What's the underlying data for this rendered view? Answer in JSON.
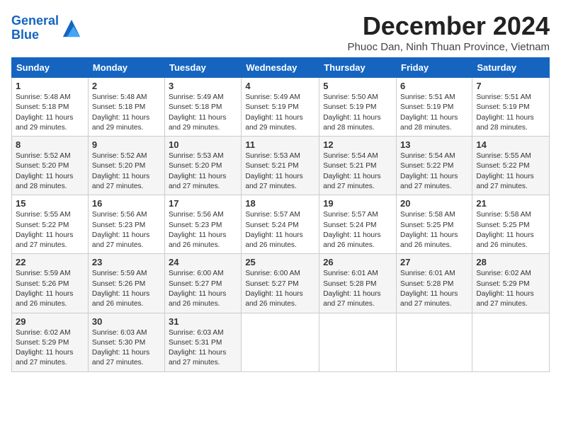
{
  "logo": {
    "line1": "General",
    "line2": "Blue"
  },
  "title": "December 2024",
  "subtitle": "Phuoc Dan, Ninh Thuan Province, Vietnam",
  "headers": [
    "Sunday",
    "Monday",
    "Tuesday",
    "Wednesday",
    "Thursday",
    "Friday",
    "Saturday"
  ],
  "weeks": [
    [
      {
        "day": "1",
        "info": "Sunrise: 5:48 AM\nSunset: 5:18 PM\nDaylight: 11 hours\nand 29 minutes."
      },
      {
        "day": "2",
        "info": "Sunrise: 5:48 AM\nSunset: 5:18 PM\nDaylight: 11 hours\nand 29 minutes."
      },
      {
        "day": "3",
        "info": "Sunrise: 5:49 AM\nSunset: 5:18 PM\nDaylight: 11 hours\nand 29 minutes."
      },
      {
        "day": "4",
        "info": "Sunrise: 5:49 AM\nSunset: 5:19 PM\nDaylight: 11 hours\nand 29 minutes."
      },
      {
        "day": "5",
        "info": "Sunrise: 5:50 AM\nSunset: 5:19 PM\nDaylight: 11 hours\nand 28 minutes."
      },
      {
        "day": "6",
        "info": "Sunrise: 5:51 AM\nSunset: 5:19 PM\nDaylight: 11 hours\nand 28 minutes."
      },
      {
        "day": "7",
        "info": "Sunrise: 5:51 AM\nSunset: 5:19 PM\nDaylight: 11 hours\nand 28 minutes."
      }
    ],
    [
      {
        "day": "8",
        "info": "Sunrise: 5:52 AM\nSunset: 5:20 PM\nDaylight: 11 hours\nand 28 minutes."
      },
      {
        "day": "9",
        "info": "Sunrise: 5:52 AM\nSunset: 5:20 PM\nDaylight: 11 hours\nand 27 minutes."
      },
      {
        "day": "10",
        "info": "Sunrise: 5:53 AM\nSunset: 5:20 PM\nDaylight: 11 hours\nand 27 minutes."
      },
      {
        "day": "11",
        "info": "Sunrise: 5:53 AM\nSunset: 5:21 PM\nDaylight: 11 hours\nand 27 minutes."
      },
      {
        "day": "12",
        "info": "Sunrise: 5:54 AM\nSunset: 5:21 PM\nDaylight: 11 hours\nand 27 minutes."
      },
      {
        "day": "13",
        "info": "Sunrise: 5:54 AM\nSunset: 5:22 PM\nDaylight: 11 hours\nand 27 minutes."
      },
      {
        "day": "14",
        "info": "Sunrise: 5:55 AM\nSunset: 5:22 PM\nDaylight: 11 hours\nand 27 minutes."
      }
    ],
    [
      {
        "day": "15",
        "info": "Sunrise: 5:55 AM\nSunset: 5:22 PM\nDaylight: 11 hours\nand 27 minutes."
      },
      {
        "day": "16",
        "info": "Sunrise: 5:56 AM\nSunset: 5:23 PM\nDaylight: 11 hours\nand 27 minutes."
      },
      {
        "day": "17",
        "info": "Sunrise: 5:56 AM\nSunset: 5:23 PM\nDaylight: 11 hours\nand 26 minutes."
      },
      {
        "day": "18",
        "info": "Sunrise: 5:57 AM\nSunset: 5:24 PM\nDaylight: 11 hours\nand 26 minutes."
      },
      {
        "day": "19",
        "info": "Sunrise: 5:57 AM\nSunset: 5:24 PM\nDaylight: 11 hours\nand 26 minutes."
      },
      {
        "day": "20",
        "info": "Sunrise: 5:58 AM\nSunset: 5:25 PM\nDaylight: 11 hours\nand 26 minutes."
      },
      {
        "day": "21",
        "info": "Sunrise: 5:58 AM\nSunset: 5:25 PM\nDaylight: 11 hours\nand 26 minutes."
      }
    ],
    [
      {
        "day": "22",
        "info": "Sunrise: 5:59 AM\nSunset: 5:26 PM\nDaylight: 11 hours\nand 26 minutes."
      },
      {
        "day": "23",
        "info": "Sunrise: 5:59 AM\nSunset: 5:26 PM\nDaylight: 11 hours\nand 26 minutes."
      },
      {
        "day": "24",
        "info": "Sunrise: 6:00 AM\nSunset: 5:27 PM\nDaylight: 11 hours\nand 26 minutes."
      },
      {
        "day": "25",
        "info": "Sunrise: 6:00 AM\nSunset: 5:27 PM\nDaylight: 11 hours\nand 26 minutes."
      },
      {
        "day": "26",
        "info": "Sunrise: 6:01 AM\nSunset: 5:28 PM\nDaylight: 11 hours\nand 27 minutes."
      },
      {
        "day": "27",
        "info": "Sunrise: 6:01 AM\nSunset: 5:28 PM\nDaylight: 11 hours\nand 27 minutes."
      },
      {
        "day": "28",
        "info": "Sunrise: 6:02 AM\nSunset: 5:29 PM\nDaylight: 11 hours\nand 27 minutes."
      }
    ],
    [
      {
        "day": "29",
        "info": "Sunrise: 6:02 AM\nSunset: 5:29 PM\nDaylight: 11 hours\nand 27 minutes."
      },
      {
        "day": "30",
        "info": "Sunrise: 6:03 AM\nSunset: 5:30 PM\nDaylight: 11 hours\nand 27 minutes."
      },
      {
        "day": "31",
        "info": "Sunrise: 6:03 AM\nSunset: 5:31 PM\nDaylight: 11 hours\nand 27 minutes."
      },
      {
        "day": "",
        "info": ""
      },
      {
        "day": "",
        "info": ""
      },
      {
        "day": "",
        "info": ""
      },
      {
        "day": "",
        "info": ""
      }
    ]
  ]
}
